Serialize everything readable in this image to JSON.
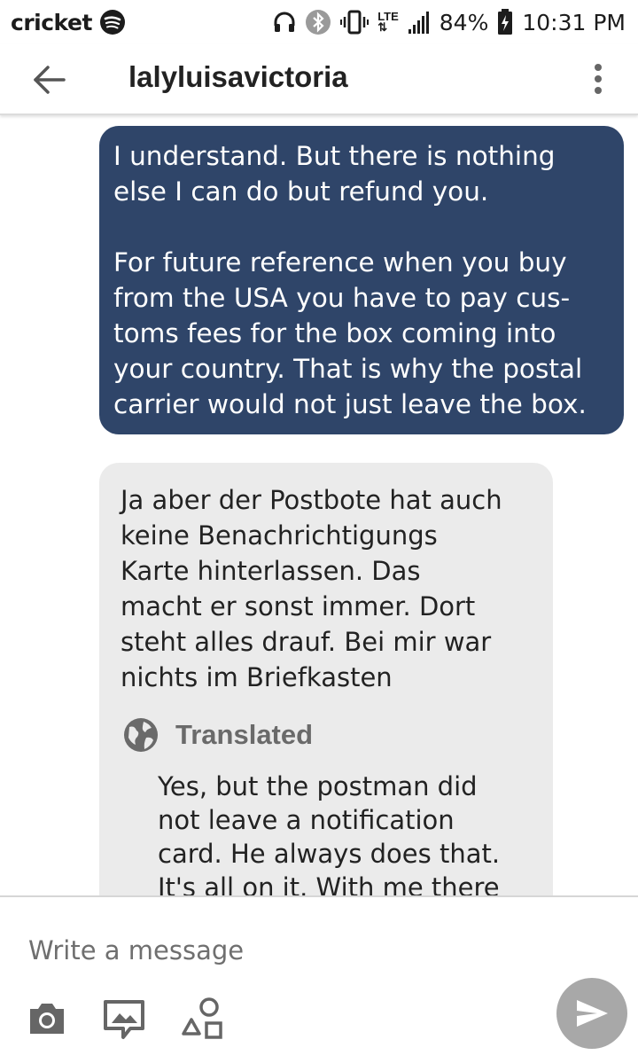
{
  "status_bar": {
    "carrier": "cricket",
    "network": "LTE",
    "battery": "84%",
    "time": "10:31 PM",
    "icons": [
      "spotify-icon",
      "headphones-icon",
      "bluetooth-icon",
      "vibrate-icon",
      "lte-icon",
      "signal-icon",
      "battery-charging-icon"
    ]
  },
  "header": {
    "title": "lalyluisavictoria",
    "back_icon": "arrow-left-icon",
    "menu_icon": "more-vertical-icon"
  },
  "messages": [
    {
      "direction": "outgoing",
      "text": "I understand.   But there is nothing\nelse I can do but refund you.\n\nFor future reference when you buy\nfrom the USA you have to pay cus-\ntoms fees for the box coming into\nyour country.   That is why the postal\ncarrier would not just leave the box."
    },
    {
      "direction": "incoming",
      "text": "Ja aber der Postbote hat auch\nkeine Benachrichtigungs\nKarte hinterlassen.  Das\nmacht er sonst immer. Dort\nsteht alles drauf.  Bei mir war\nnichts im Briefkasten",
      "translated_label": "Translated",
      "translation": "Yes, but the postman did\nnot leave a notification\ncard. He always does that.\nIt's all on it. With me there"
    }
  ],
  "composer": {
    "placeholder": "Write a message",
    "tools": [
      "camera-icon",
      "message-image-icon",
      "shapes-icon"
    ],
    "send_icon": "send-icon"
  },
  "colors": {
    "outgoing_bubble": "#2f4569",
    "incoming_bubble": "#ebebeb",
    "send_button": "#a8a8a8"
  }
}
